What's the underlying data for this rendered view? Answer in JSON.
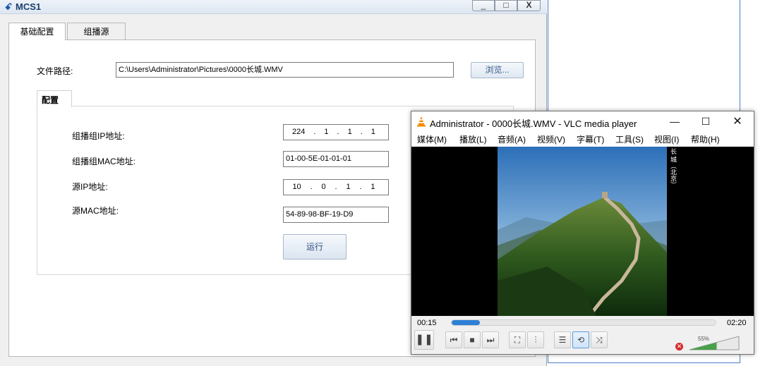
{
  "mcs_window": {
    "title": "MCS1",
    "controls": {
      "minimize": "_",
      "maximize": "□",
      "close": "X"
    },
    "tabs": [
      {
        "label": "基础配置",
        "active": true
      },
      {
        "label": "组播源",
        "active": false
      }
    ],
    "file_path": {
      "label": "文件路径:",
      "value": "C:\\Users\\Administrator\\Pictures\\0000长城.WMV",
      "browse_label": "浏览..."
    },
    "config": {
      "section_title": "配置",
      "group_ip_label": "组播组IP地址:",
      "group_ip": [
        "224",
        "1",
        "1",
        "1"
      ],
      "group_mac_label": "组播组MAC地址:",
      "group_mac": "01-00-5E-01-01-01",
      "src_ip_label": "源IP地址:",
      "src_ip": [
        "10",
        "0",
        "1",
        "1"
      ],
      "src_mac_label": "源MAC地址:",
      "src_mac": "54-89-98-BF-19-D9",
      "run_label": "运行"
    }
  },
  "vlc_window": {
    "title": "Administrator - 0000长城.WMV - VLC media player",
    "controls": {
      "minimize": "—",
      "maximize": "☐",
      "close": "✕"
    },
    "menu": [
      "媒体(M)",
      "播放(L)",
      "音频(A)",
      "视频(V)",
      "字幕(T)",
      "工具(S)",
      "视图(I)",
      "帮助(H)"
    ],
    "video_caption": "长 城（北京）",
    "time_current": "00:15",
    "time_total": "02:20",
    "progress_fraction": 0.107,
    "volume_text": "55%",
    "volume_fraction": 0.55,
    "accent_color": "#2e7fd6"
  }
}
